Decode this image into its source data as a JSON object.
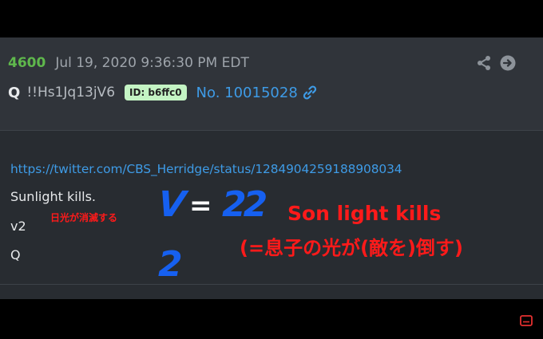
{
  "post": {
    "number": "4600",
    "timestamp": "Jul 19, 2020 9:36:30 PM EDT",
    "author": "Q",
    "tripcode": "!!Hs1Jq13jV6",
    "id_badge": "ID: b6ffc0",
    "post_no": "No. 10015028",
    "link": "https://twitter.com/CBS_Herridge/status/1284904259188908034",
    "lines": [
      "Sunlight kills.",
      "v2",
      "Q"
    ]
  },
  "annotations": {
    "jp_small": "日光が消滅する",
    "v_equals_left": "V",
    "equals": "=",
    "v_equals_right": "22",
    "two": "2",
    "son_light": "Son light kills",
    "son_light_jp": "(=息子の光が(敵を)倒す)"
  },
  "colors": {
    "post_number": "#5fb84c",
    "link": "#3e9be6",
    "badge_bg": "#c4f4c4",
    "annotation_red": "#ff1a1a",
    "annotation_blue": "#1660f0"
  },
  "icons": [
    "share-icon",
    "arrow-right-circle-icon",
    "link-icon",
    "subtitle-icon"
  ]
}
